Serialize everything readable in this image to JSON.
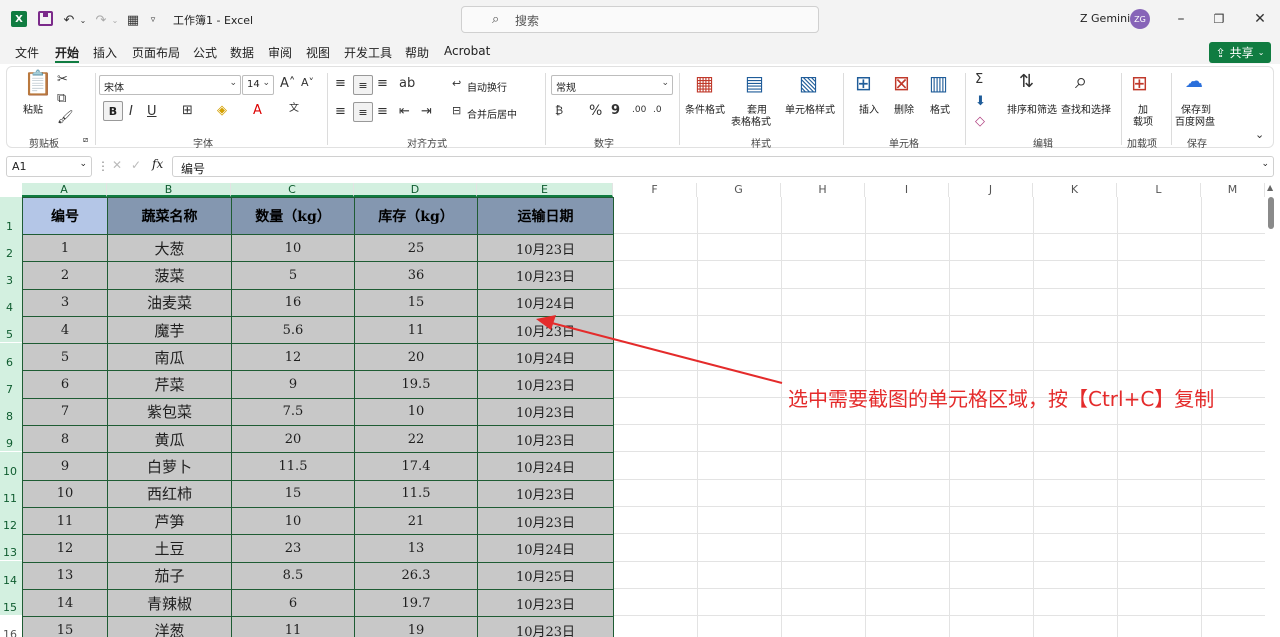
{
  "titlebar": {
    "app_icon": "X",
    "doc_title": "工作簿1 - Excel",
    "search_placeholder": "搜索",
    "user_name": "Z Gemini",
    "avatar_initials": "ZG"
  },
  "menu": [
    "文件",
    "开始",
    "插入",
    "页面布局",
    "公式",
    "数据",
    "审阅",
    "视图",
    "开发工具",
    "帮助",
    "Acrobat"
  ],
  "active_menu": "开始",
  "share_label": "共享",
  "ribbon": {
    "paste": "粘贴",
    "clipboard": "剪贴板",
    "font_name": "宋体",
    "font_size": "14",
    "bold": "B",
    "italic": "I",
    "underline": "U",
    "font": "字体",
    "wrap_text": "自动换行",
    "merge_center": "合并后居中",
    "alignment": "对齐方式",
    "number_format": "常规",
    "percent": "%",
    "comma": "9",
    "number": "数字",
    "cond_format": "条件格式",
    "table_format_1": "套用",
    "table_format_2": "表格格式",
    "cell_style": "单元格样式",
    "styles": "样式",
    "insert": "插入",
    "delete": "删除",
    "format": "格式",
    "cells": "单元格",
    "sort_filter": "排序和筛选",
    "find_select": "查找和选择",
    "editing": "编辑",
    "addin_1": "加",
    "addin_2": "载项",
    "addins": "加载项",
    "save_to_1": "保存到",
    "save_to_2": "百度网盘",
    "save": "保存"
  },
  "formula_bar": {
    "cell_ref": "A1",
    "fx": "fx",
    "content": "编号"
  },
  "columns": [
    "A",
    "B",
    "C",
    "D",
    "E",
    "F",
    "G",
    "H",
    "I",
    "J",
    "K",
    "L",
    "M"
  ],
  "rows": [
    "1",
    "2",
    "3",
    "4",
    "5",
    "6",
    "7",
    "8",
    "9",
    "10",
    "11",
    "12",
    "13",
    "14",
    "15",
    "16"
  ],
  "table": {
    "headers": [
      "编号",
      "蔬菜名称",
      "数量（kg）",
      "库存（kg）",
      "运输日期"
    ],
    "rows": [
      [
        "1",
        "大葱",
        "10",
        "25",
        "10月23日"
      ],
      [
        "2",
        "菠菜",
        "5",
        "36",
        "10月23日"
      ],
      [
        "3",
        "油麦菜",
        "16",
        "15",
        "10月24日"
      ],
      [
        "4",
        "魔芋",
        "5.6",
        "11",
        "10月23日"
      ],
      [
        "5",
        "南瓜",
        "12",
        "20",
        "10月24日"
      ],
      [
        "6",
        "芹菜",
        "9",
        "19.5",
        "10月23日"
      ],
      [
        "7",
        "紫包菜",
        "7.5",
        "10",
        "10月23日"
      ],
      [
        "8",
        "黄瓜",
        "20",
        "22",
        "10月23日"
      ],
      [
        "9",
        "白萝卜",
        "11.5",
        "17.4",
        "10月24日"
      ],
      [
        "10",
        "西红柿",
        "15",
        "11.5",
        "10月23日"
      ],
      [
        "11",
        "芦笋",
        "10",
        "21",
        "10月23日"
      ],
      [
        "12",
        "土豆",
        "23",
        "13",
        "10月24日"
      ],
      [
        "13",
        "茄子",
        "8.5",
        "26.3",
        "10月25日"
      ],
      [
        "14",
        "青辣椒",
        "6",
        "19.7",
        "10月23日"
      ],
      [
        "15",
        "洋葱",
        "11",
        "19",
        "10月23日"
      ]
    ]
  },
  "annotation": {
    "text": "选中需要截图的单元格区域，按【Ctrl+C】复制",
    "color": "#e42b2b"
  },
  "colors": {
    "accent": "#107c41",
    "header_fill": "#8497b0",
    "first_header_fill": "#b4c6e7",
    "cell_fill": "#c8c8c8"
  }
}
